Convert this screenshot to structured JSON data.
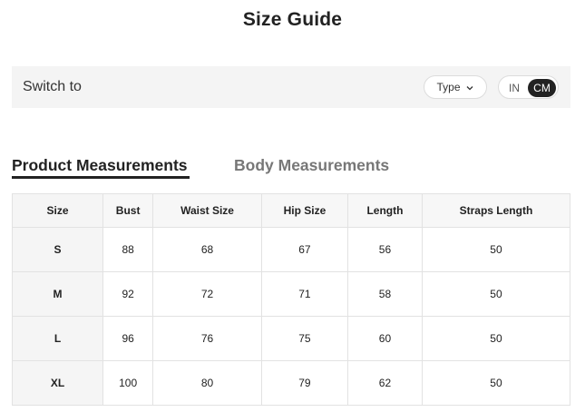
{
  "page": {
    "title": "Size Guide"
  },
  "switch_bar": {
    "label": "Switch to",
    "type_label": "Type",
    "type_icon": "chevron-down-icon",
    "units": [
      "IN",
      "CM"
    ],
    "selected_unit": "CM"
  },
  "tabs": [
    {
      "label": "Product Measurements",
      "active": true
    },
    {
      "label": "Body Measurements",
      "active": false
    }
  ],
  "table": {
    "headers": [
      "Size",
      "Bust",
      "Waist Size",
      "Hip Size",
      "Length",
      "Straps Length"
    ],
    "rows": [
      [
        "S",
        "88",
        "68",
        "67",
        "56",
        "50"
      ],
      [
        "M",
        "92",
        "72",
        "71",
        "58",
        "50"
      ],
      [
        "L",
        "96",
        "76",
        "75",
        "60",
        "50"
      ],
      [
        "XL",
        "100",
        "80",
        "79",
        "62",
        "50"
      ]
    ]
  },
  "colors": {
    "accent": "#222222",
    "bar_bg": "#f4f4f4",
    "inactive_tab": "#777777"
  }
}
